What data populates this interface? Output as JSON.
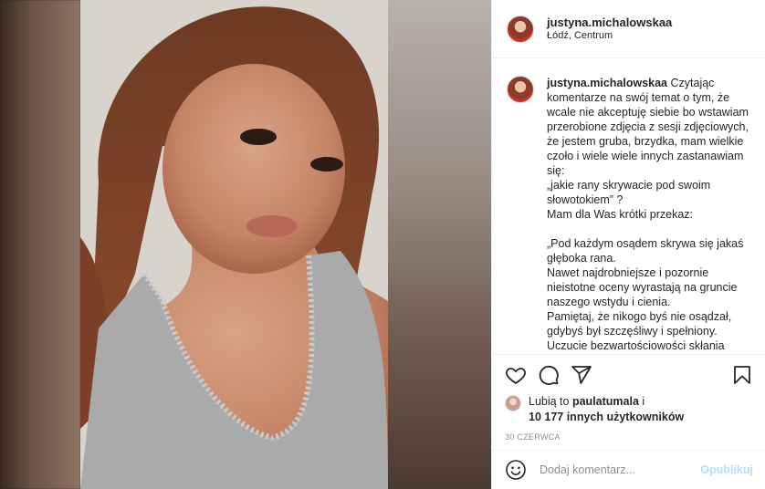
{
  "post": {
    "username": "justyna.michalowskaa",
    "location": "Łódź, Centrum"
  },
  "caption": {
    "username": "justyna.michalowskaa",
    "text": " Czytając komentarze na swój temat o tym, że wcale nie akceptuję siebie bo wstawiam przerobione zdjęcia z sesji zdjęciowych, że jestem gruba, brzydka, mam wielkie czoło i wiele wiele innych zastanawiam się:\n„jakie rany skrywacie pod swoim słowotokiem” ?\nMam dla Was krótki przekaz:\n\n„Pod każdym osądem skrywa się jakaś głęboka rana.\nNawet najdrobniejsze i pozornie nieistotne oceny wyrastają na gruncie naszego wstydu i cienia.\nPamiętaj, że nikogo byś nie osądzał, gdybyś był szczęśliwy i spełniony.\nUczucie bezwartościowości skłania"
  },
  "actions": {
    "icons": [
      "heart-icon",
      "comment-icon",
      "share-icon",
      "bookmark-icon"
    ]
  },
  "likes": {
    "prefix": "Lubią to ",
    "user": "paulatumala",
    "middle": " i",
    "count": "10 177 innych użytkowników"
  },
  "date": "30 CZERWCA",
  "comment": {
    "placeholder": "Dodaj komentarz...",
    "publish_label": "Opublikuj"
  },
  "colors": {
    "text": "#262626",
    "muted": "#8e8e8e",
    "publish_disabled": "#b2dffc",
    "border": "#efefef"
  }
}
